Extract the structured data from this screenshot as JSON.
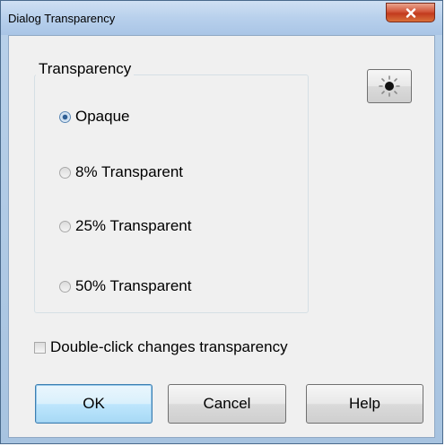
{
  "window": {
    "title": "Dialog Transparency",
    "close_icon": "close-x-icon"
  },
  "group": {
    "label": "Transparency",
    "options": [
      {
        "label": "Opaque",
        "selected": true
      },
      {
        "label": "8% Transparent",
        "selected": false
      },
      {
        "label": "25% Transparent",
        "selected": false
      },
      {
        "label": "50% Transparent",
        "selected": false
      }
    ]
  },
  "sun_button": {
    "icon": "sun-icon"
  },
  "checkbox": {
    "label": "Double-click changes transparency",
    "checked": false
  },
  "buttons": {
    "ok": "OK",
    "cancel": "Cancel",
    "help": "Help"
  },
  "colors": {
    "title_bar": "#b9d1ea",
    "close_button": "#c7432a",
    "dialog_bg": "#f0f0f0",
    "default_button_border": "#3c7fb1"
  }
}
